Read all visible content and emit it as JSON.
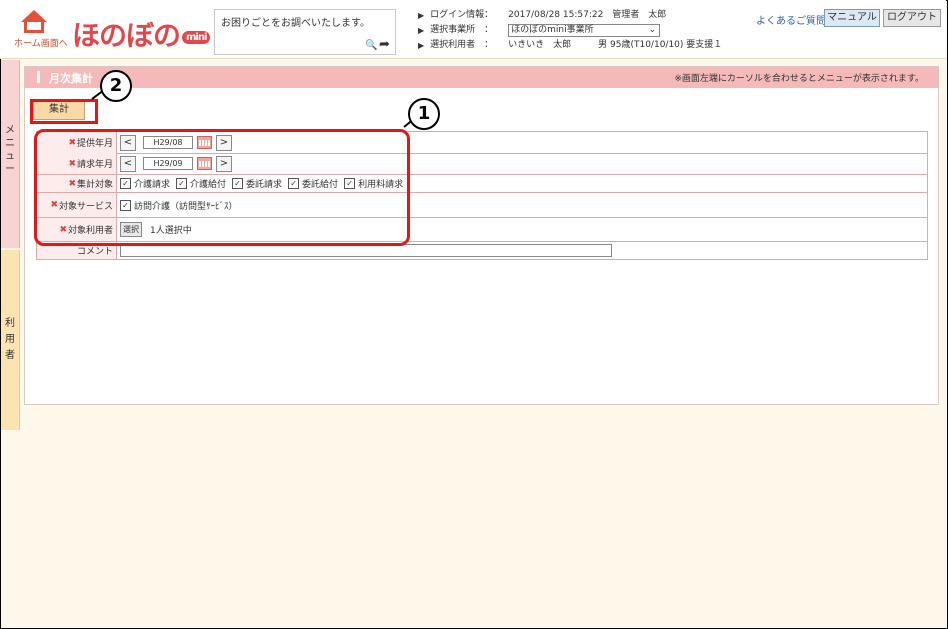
{
  "header": {
    "home_label": "ホーム画面へ",
    "logo_text": "ほのぼの",
    "logo_mini": "mini",
    "search_placeholder": "お困りごとをお調べいたします。",
    "login_label": "ログイン情報：",
    "login_value": "2017/08/28 15:57:22　管理者　太郎",
    "office_label": "選択事業所　：",
    "office_value": "ほのぼのmini事業所",
    "user_label": "選択利用者　：",
    "user_value": "いきいき　太郎　　　男 95歳(T10/10/10) 要支援１",
    "help_link": "よくあるご質問",
    "manual_button": "マニュアル",
    "logout_button": "ログアウト"
  },
  "side": {
    "menu_label": "メニュー",
    "user_label": "利用者"
  },
  "page": {
    "title": "月次集計",
    "note": "※画面左端にカーソルを合わせるとメニューが表示されます。",
    "aggregate_button": "集計"
  },
  "form": {
    "provide_month_label": "提供年月",
    "provide_month_value": "H29/08",
    "billing_month_label": "請求年月",
    "billing_month_value": "H29/09",
    "target_label": "集計対象",
    "target_options": [
      "介護請求",
      "介護給付",
      "委託請求",
      "委託給付",
      "利用料請求"
    ],
    "service_label": "対象サービス",
    "service_option": "訪問介護（訪問型ｻｰﾋﾞｽ）",
    "users_label": "対象利用者",
    "select_button": "選択",
    "users_value": "1人選択中",
    "comment_label": "コメント",
    "required_mark": "✖"
  },
  "annotations": {
    "one": "1",
    "two": "2"
  },
  "colors": {
    "title_bar": "#f4b9b8",
    "annotation": "#e01818",
    "accent": "#e2484b"
  }
}
